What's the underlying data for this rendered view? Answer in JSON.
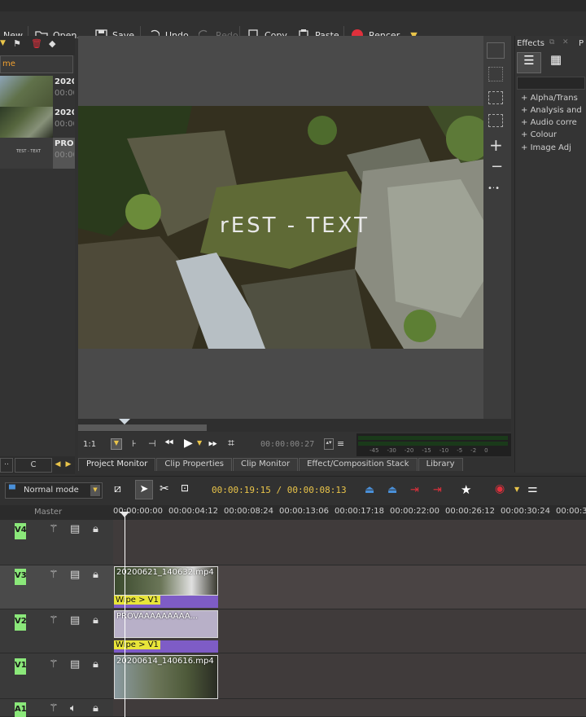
{
  "toolbar": {
    "new_label": "New",
    "open_label": "Open...",
    "save_label": "Save",
    "undo_label": "Undo",
    "redo_label": "Redo",
    "copy_label": "Copy",
    "paste_label": "Paste",
    "render_label": "Rencer"
  },
  "bin": {
    "header": "me",
    "clips": [
      {
        "name": "2020",
        "time": "00:00"
      },
      {
        "name": "2020",
        "time": "00:00"
      },
      {
        "name": "PRO",
        "time": "00:00",
        "thumb_text": "TEST - TEXT"
      }
    ],
    "search_label": "C"
  },
  "monitor": {
    "overlay_text": "rEST - TEXT",
    "zoom": "1:1",
    "timecode": "00:00:00:27",
    "vu_scale": [
      "-45",
      "-30",
      "-20",
      "-15",
      "-10",
      "-5",
      "-2",
      "0"
    ]
  },
  "tabs": [
    "Project Monitor",
    "Clip Properties",
    "Clip Monitor",
    "Effect/Composition Stack",
    "Library"
  ],
  "effects": {
    "title": "Effects",
    "title2": "P",
    "categories": [
      "Alpha/Trans",
      "Analysis and",
      "Audio corre",
      "Colour",
      "Image Adj"
    ]
  },
  "timeline": {
    "mode": "Normal mode",
    "timecode": "00:00:19:15 / 00:00:08:13",
    "master_label": "Master",
    "ruler": [
      "00:00:00:00",
      "00:00:04:12",
      "00:00:08:24",
      "00:00:13:06",
      "00:00:17:18",
      "00:00:22:00",
      "00:00:26:12",
      "00:00:30:24",
      "00:00:3"
    ],
    "tracks": [
      {
        "name": "V4"
      },
      {
        "name": "V3",
        "clip": "20200621_140632.mp4",
        "transition": "Wipe > V1"
      },
      {
        "name": "V2",
        "clip": "PROVAAAAAAAAA...",
        "transition": "Wipe > V1"
      },
      {
        "name": "V1",
        "clip": "20200614_140616.mp4"
      },
      {
        "name": "A1"
      }
    ]
  },
  "colors": {
    "accent": "#e9c44a",
    "track_label": "#8be87a",
    "transition": "#7e5cc6",
    "render_dot": "#e0303c"
  }
}
